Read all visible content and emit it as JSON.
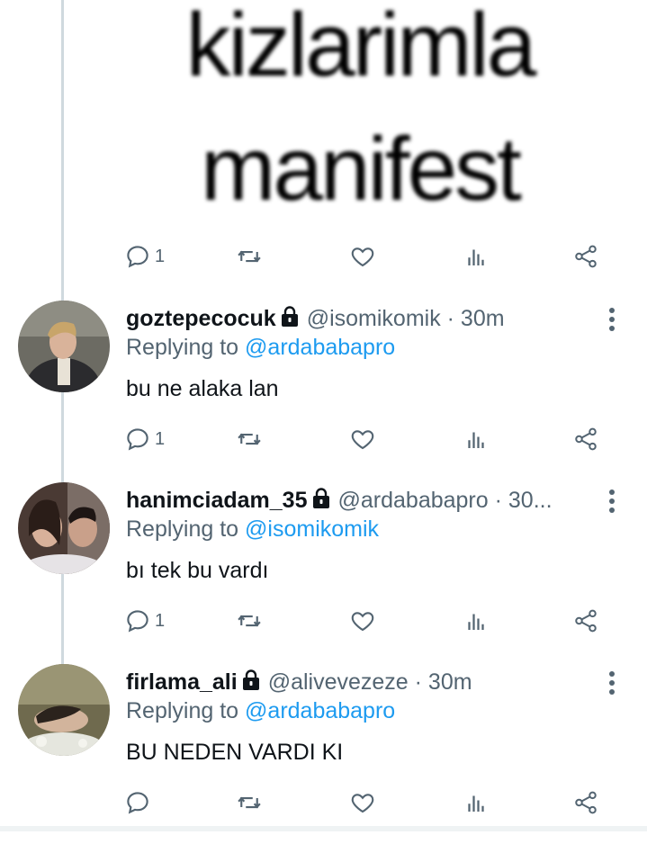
{
  "meme": {
    "line1": "kizlarimla",
    "line2": "manifest"
  },
  "original_actions": {
    "reply_count": "1"
  },
  "tweets": [
    {
      "display_name": "goztepecocuk",
      "handle_time": "@isomikomik · 30m",
      "replying_label": "Replying to ",
      "replying_to": "@ardababapro",
      "text": "bu ne alaka lan",
      "reply_count": "1"
    },
    {
      "display_name": "hanimciadam_35",
      "handle_time": "@ardababapro · 30...",
      "replying_label": "Replying to ",
      "replying_to": "@isomikomik",
      "text": "bı tek bu vardı",
      "reply_count": "1"
    },
    {
      "display_name": "firlama_ali",
      "handle_time": "@alivevezeze · 30m",
      "replying_label": "Replying to ",
      "replying_to": "@ardababapro",
      "text": "BU NEDEN VARDI KI",
      "reply_count": ""
    }
  ],
  "colors": {
    "link": "#1d9bf0",
    "secondary": "#536471",
    "thread_line": "#cfd9de"
  },
  "icons": [
    "reply-icon",
    "retweet-icon",
    "like-icon",
    "stats-icon",
    "share-icon",
    "lock-icon",
    "more-icon"
  ]
}
